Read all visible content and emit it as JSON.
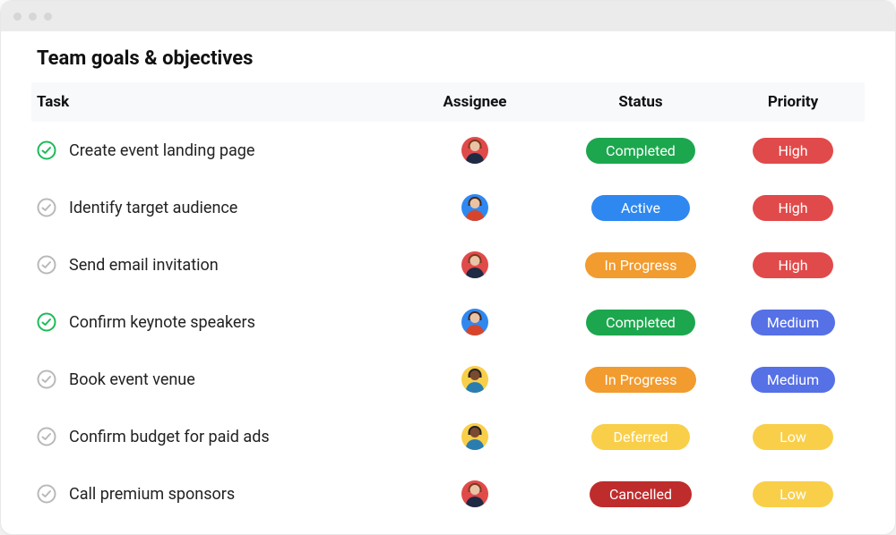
{
  "title": "Team goals & objectives",
  "columns": {
    "task": "Task",
    "assignee": "Assignee",
    "status": "Status",
    "priority": "Priority"
  },
  "colors": {
    "green": "#1CA74E",
    "blue": "#2F88F0",
    "orange": "#F29B2E",
    "red": "#E14A4A",
    "darkred": "#BF2C2C",
    "yellow": "#F9CF4A",
    "medium_blue": "#5670E6",
    "check_done": "#1CBB5A",
    "check_todo": "#B9B9B9"
  },
  "tasks": [
    {
      "name": "Create event landing page",
      "done": true,
      "assignee": {
        "bg": "#E14A4A",
        "hair": "#7a3a1e",
        "shirt": "#1f2a44"
      },
      "status": {
        "label": "Completed",
        "color_key": "green"
      },
      "priority": {
        "label": "High",
        "color_key": "red"
      }
    },
    {
      "name": "Identify target audience",
      "done": false,
      "assignee": {
        "bg": "#2F88F0",
        "hair": "#4a2518",
        "shirt": "#d6452b"
      },
      "status": {
        "label": "Active",
        "color_key": "blue"
      },
      "priority": {
        "label": "High",
        "color_key": "red"
      }
    },
    {
      "name": "Send email invitation",
      "done": false,
      "assignee": {
        "bg": "#E14A4A",
        "hair": "#7a3a1e",
        "shirt": "#1f2a44"
      },
      "status": {
        "label": "In Progress",
        "color_key": "orange"
      },
      "priority": {
        "label": "High",
        "color_key": "red"
      }
    },
    {
      "name": "Confirm keynote speakers",
      "done": true,
      "assignee": {
        "bg": "#2F88F0",
        "hair": "#4a2518",
        "shirt": "#d6452b"
      },
      "status": {
        "label": "Completed",
        "color_key": "green"
      },
      "priority": {
        "label": "Medium",
        "color_key": "medium_blue"
      }
    },
    {
      "name": "Book event venue",
      "done": false,
      "assignee": {
        "bg": "#F9CF4A",
        "hair": "#222",
        "shirt": "#2a7db0",
        "skin": "#7a4a30"
      },
      "status": {
        "label": "In Progress",
        "color_key": "orange"
      },
      "priority": {
        "label": "Medium",
        "color_key": "medium_blue"
      }
    },
    {
      "name": "Confirm budget for paid ads",
      "done": false,
      "assignee": {
        "bg": "#F9CF4A",
        "hair": "#222",
        "shirt": "#2a7db0",
        "skin": "#7a4a30"
      },
      "status": {
        "label": "Deferred",
        "color_key": "yellow"
      },
      "priority": {
        "label": "Low",
        "color_key": "yellow"
      }
    },
    {
      "name": "Call premium sponsors",
      "done": false,
      "assignee": {
        "bg": "#E14A4A",
        "hair": "#7a3a1e",
        "shirt": "#1f2a44"
      },
      "status": {
        "label": "Cancelled",
        "color_key": "darkred"
      },
      "priority": {
        "label": "Low",
        "color_key": "yellow"
      }
    }
  ]
}
